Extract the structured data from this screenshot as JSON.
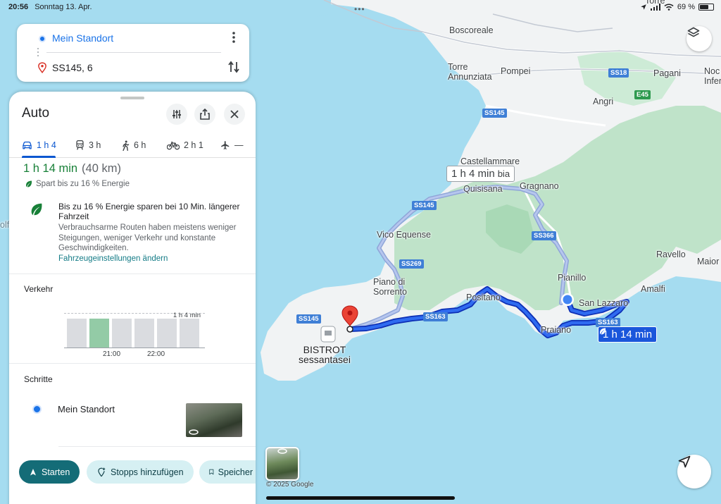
{
  "status_bar": {
    "time": "20:56",
    "date": "Sonntag 13. Apr.",
    "battery_percent": "69 %",
    "battery_level": 0.69,
    "more_dots": "•••"
  },
  "search": {
    "origin": "Mein Standort",
    "destination": "SS145, 6"
  },
  "panel": {
    "title": "Auto",
    "modes": [
      {
        "icon": "car-icon",
        "label": "1 h 4",
        "active": true
      },
      {
        "icon": "train-icon",
        "label": "3 h"
      },
      {
        "icon": "walk-icon",
        "label": "6 h"
      },
      {
        "icon": "bike-icon",
        "label": "2 h 1"
      },
      {
        "icon": "plane-icon",
        "label": "—"
      }
    ],
    "summary": {
      "duration": "1 h 14 min",
      "distance": "(40 km)",
      "saves": "Spart bis zu 16 % Energie"
    },
    "eco": {
      "title": "Bis zu 16 % Energie sparen bei 10 Min. längerer Fahrzeit",
      "description": "Verbrauchsarme Routen haben meistens weniger Steigungen, weniger Verkehr und konstante Geschwindigkeiten.",
      "link": "Fahrzeugeinstellungen ändern"
    },
    "traffic": {
      "heading": "Verkehr",
      "ref_label": "1 h 4 min",
      "ticks": [
        "21:00",
        "22:00"
      ],
      "bars": [
        0.85,
        0.85,
        0.85,
        0.85,
        0.85,
        0.85
      ],
      "current_index": 1
    },
    "steps": {
      "heading": "Schritte",
      "first": "Mein Standort"
    },
    "actions": {
      "start": "Starten",
      "add_stops": "Stopps hinzufügen",
      "save": "Speicher"
    }
  },
  "map": {
    "labels": {
      "boscoreale": "Boscoreale",
      "torre": "Torre\nAnnunziata",
      "pompei": "Pompei",
      "pagani": "Pagani",
      "nocera": "Noc\nInfer",
      "angri": "Angri",
      "castellammare": "Castellammare",
      "stabia": "bia",
      "quisisana": "Quisisana",
      "gragnano": "Gragnano",
      "vico": "Vico Equense",
      "pianillo": "Pianillo",
      "ravello": "Ravello",
      "maiori": "Maior",
      "amalfi": "Amalfi",
      "piano": "Piano di\nSorrento",
      "positano": "Positano",
      "san_lazzaro": "San Lazzaro",
      "praiano": "Praiano",
      "bistrot": "BISTROT\nsessantasei",
      "olf": "olf",
      "torre_top": "Torre"
    },
    "shields": {
      "ss18": "SS18",
      "e45": "E45",
      "ss145a": "SS145",
      "ss145b": "SS145",
      "ss145c": "SS145",
      "ss366": "SS366",
      "ss269": "SS269",
      "ss163a": "SS163",
      "ss163b": "SS163"
    },
    "route_main": "1 h 14 min",
    "route_alt": "1 h 4 min",
    "copyright": "© 2025 Google"
  },
  "colors": {
    "water": "#a5dcf0",
    "land": "#f1f3f4",
    "green_land": "#bfe3c9",
    "route": "#1a56db",
    "accent": "#146c77"
  }
}
